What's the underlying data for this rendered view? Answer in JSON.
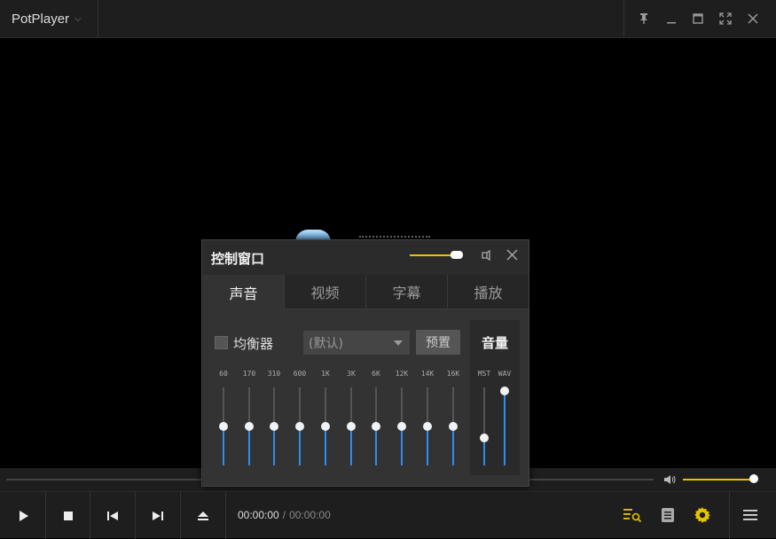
{
  "app": {
    "name": "PotPlayer"
  },
  "titlebar": {
    "pin_icon": "pin-icon",
    "minimize_icon": "minimize-icon",
    "maximize_icon": "maximize-icon",
    "fullscreen_icon": "fullscreen-icon",
    "close_icon": "close-icon"
  },
  "time": {
    "current": "00:00:00",
    "separator": "/",
    "total": "00:00:00"
  },
  "volume": {
    "level": 1.0
  },
  "dialog": {
    "title": "控制窗口",
    "opacity": 0.85,
    "tabs": [
      {
        "label": "声音",
        "active": true
      },
      {
        "label": "视频",
        "active": false
      },
      {
        "label": "字幕",
        "active": false
      },
      {
        "label": "播放",
        "active": false
      }
    ],
    "equalizer": {
      "label": "均衡器",
      "enabled": false,
      "preset_value": "(默认)",
      "preset_button": "预置",
      "bands": [
        {
          "label": "60",
          "level": 0.5
        },
        {
          "label": "170",
          "level": 0.5
        },
        {
          "label": "310",
          "level": 0.5
        },
        {
          "label": "600",
          "level": 0.5
        },
        {
          "label": "1K",
          "level": 0.5
        },
        {
          "label": "3K",
          "level": 0.5
        },
        {
          "label": "6K",
          "level": 0.5
        },
        {
          "label": "12K",
          "level": 0.5
        },
        {
          "label": "14K",
          "level": 0.5
        },
        {
          "label": "16K",
          "level": 0.5
        }
      ]
    },
    "volume_panel": {
      "title": "音量",
      "sliders": [
        {
          "label": "MST",
          "level": 0.35
        },
        {
          "label": "WAV",
          "level": 0.95
        }
      ]
    }
  },
  "colors": {
    "accent": "#e8c400",
    "slider_fill": "#2d8ef0",
    "background": "#000000",
    "chrome": "#1e1e1e"
  }
}
